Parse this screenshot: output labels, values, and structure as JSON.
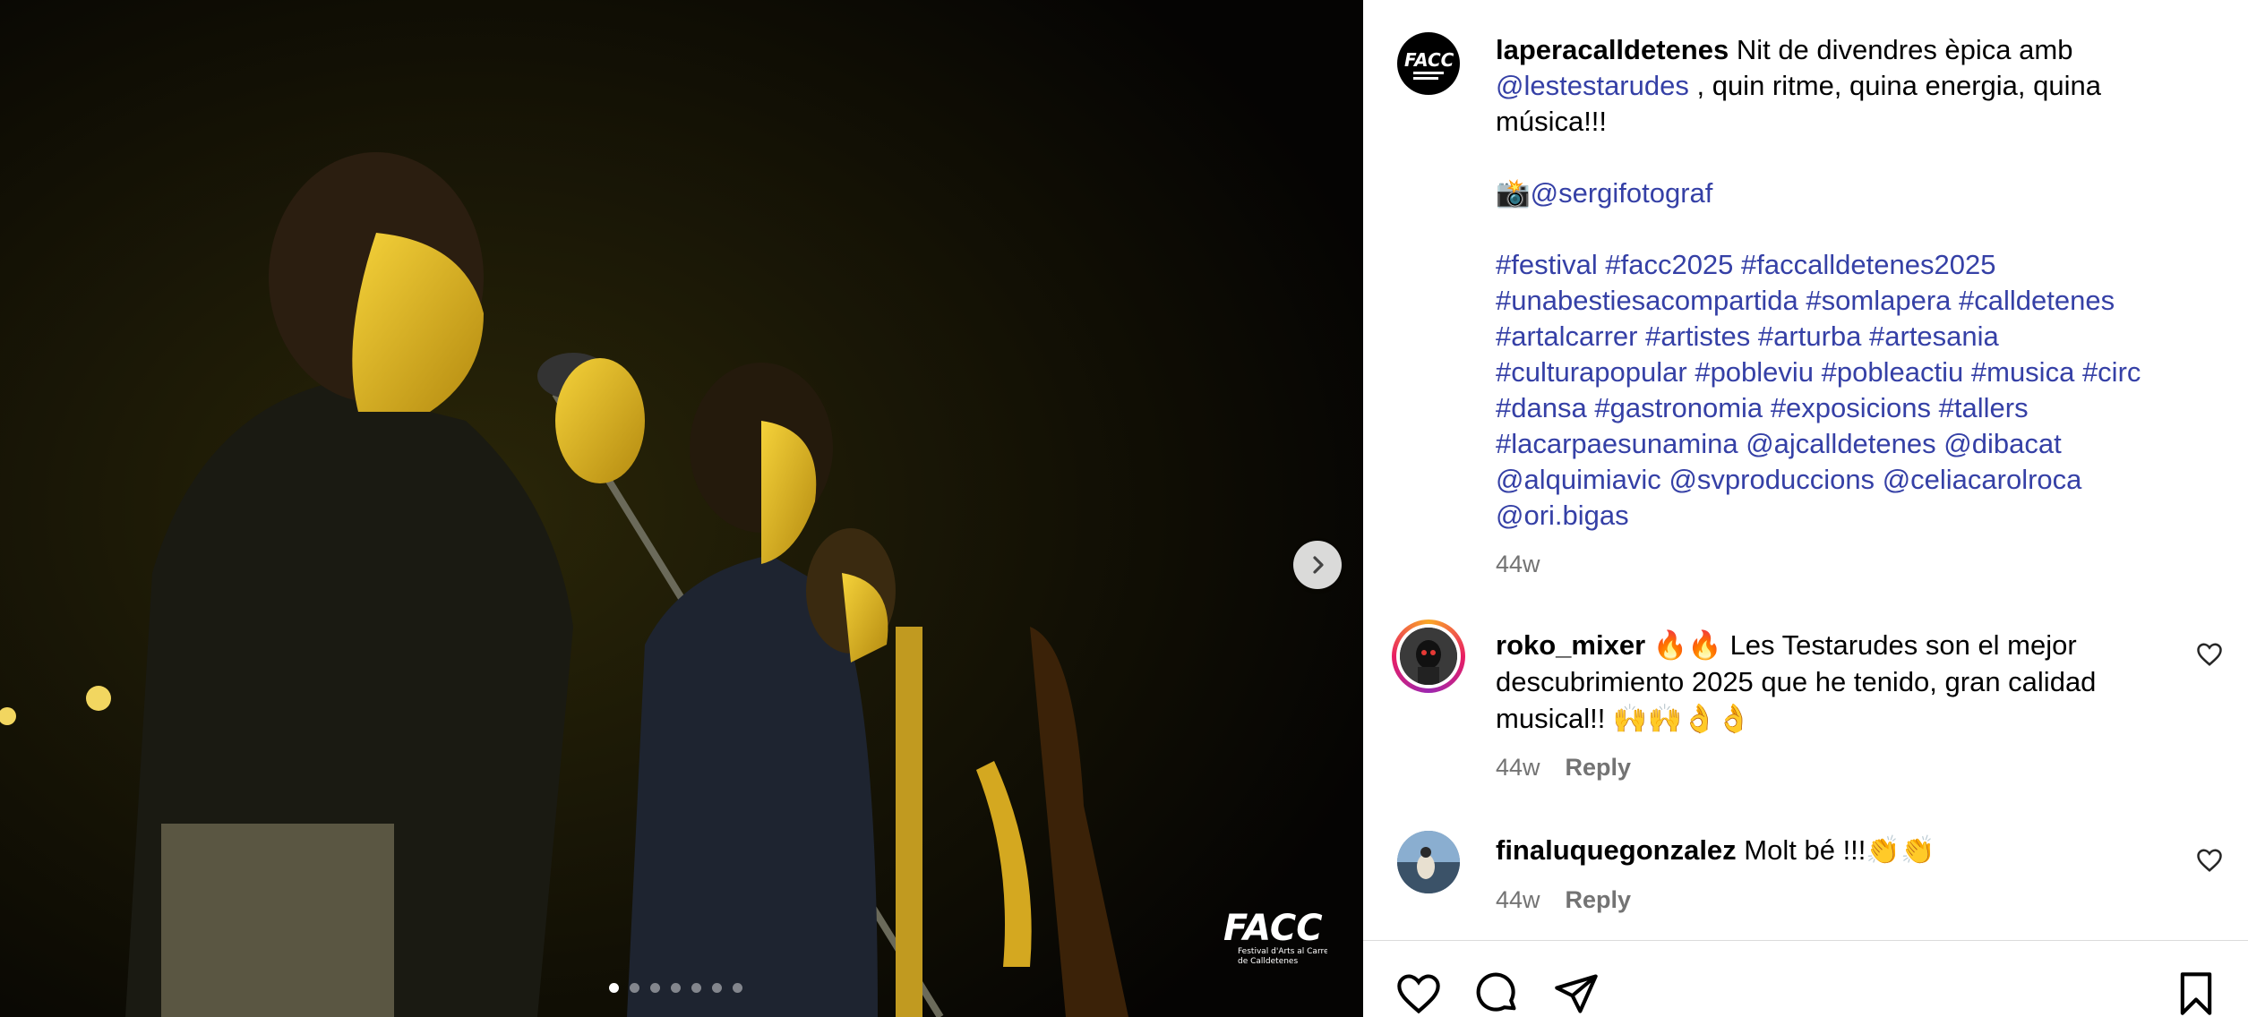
{
  "post": {
    "username": "laperacalldetenes",
    "caption_line1": " Nit de divendres èpica amb",
    "mention_main": "@lestestarudes",
    "caption_line2": " , quin ritme, quina energia, quina",
    "caption_line3": "música!!!",
    "camera_emoji": "📸",
    "photographer": "@sergifotograf",
    "tags_lines": [
      [
        "#festival",
        "#facc2025",
        "#faccalldetenes2025"
      ],
      [
        "#unabestiesacompartida",
        "#somlapera",
        "#calldetenes"
      ],
      [
        "#artalcarrer",
        "#artistes",
        "#arturba",
        "#artesania"
      ],
      [
        "#culturapopular",
        "#pobleviu",
        "#pobleactiu",
        "#musica",
        "#circ"
      ],
      [
        "#dansa",
        "#gastronomia",
        "#exposicions",
        "#tallers"
      ],
      [
        "#lacarpaesunamina",
        "@ajcalldetenes",
        "@dibacat"
      ],
      [
        "@alquimiavic",
        "@svproduccions",
        "@celiacarolroca"
      ],
      [
        "@ori.bigas"
      ]
    ],
    "time": "44w"
  },
  "comments": [
    {
      "username": "roko_mixer",
      "text_line1": " 🔥🔥 Les Testarudes son el mejor",
      "text_line2": "descubrimiento 2025 que he tenido, gran calidad",
      "text_line3": "musical!! 🙌🙌👌👌",
      "time": "44w",
      "reply": "Reply"
    },
    {
      "username": "finaluquegonzalez",
      "text_line1": " Molt bé !!!👏👏",
      "time": "44w",
      "reply": "Reply"
    }
  ],
  "media": {
    "slide_count": 7,
    "active_slide": 1,
    "watermark_text": "FACC",
    "watermark_sub1": "Festival d'Arts al Carrer",
    "watermark_sub2": "de Calldetenes"
  },
  "icons": [
    "chevron-right-icon",
    "heart-icon",
    "comment-icon",
    "share-icon",
    "bookmark-icon"
  ],
  "colors": {
    "link": "#3540a6",
    "muted": "#737373"
  }
}
